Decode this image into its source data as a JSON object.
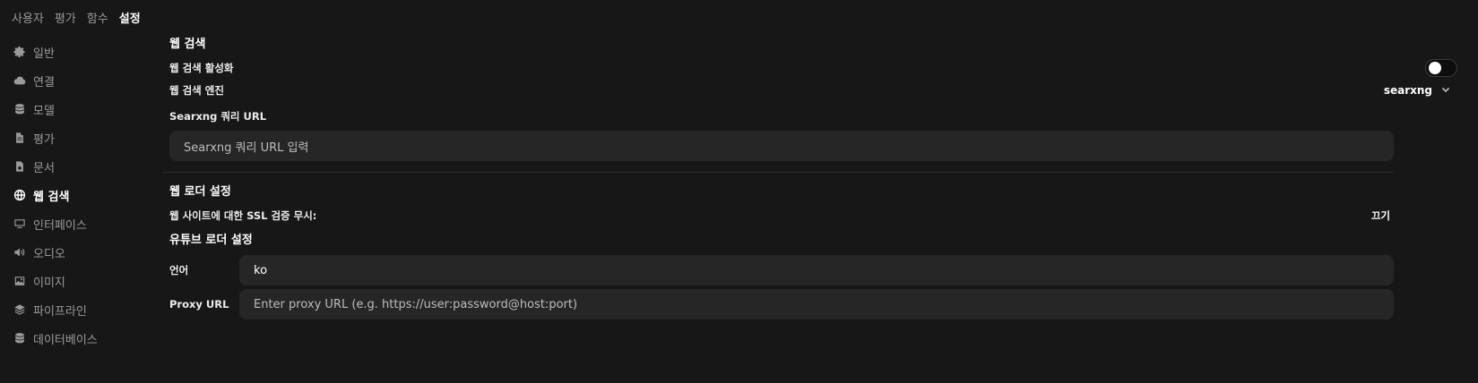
{
  "top_tabs": [
    {
      "label": "사용자"
    },
    {
      "label": "평가"
    },
    {
      "label": "함수"
    },
    {
      "label": "설정"
    }
  ],
  "sidebar": {
    "items": [
      {
        "label": "일반",
        "icon": "gear-icon"
      },
      {
        "label": "연결",
        "icon": "cloud-icon"
      },
      {
        "label": "모델",
        "icon": "database-icon"
      },
      {
        "label": "평가",
        "icon": "document-icon"
      },
      {
        "label": "문서",
        "icon": "file-icon"
      },
      {
        "label": "웹 검색",
        "icon": "globe-icon"
      },
      {
        "label": "인터페이스",
        "icon": "monitor-icon"
      },
      {
        "label": "오디오",
        "icon": "speaker-icon"
      },
      {
        "label": "이미지",
        "icon": "image-icon"
      },
      {
        "label": "파이프라인",
        "icon": "layers-icon"
      },
      {
        "label": "데이터베이스",
        "icon": "database-icon"
      }
    ]
  },
  "web_search": {
    "title": "웹 검색",
    "enable_label": "웹 검색 활성화",
    "enabled": false,
    "engine_label": "웹 검색 엔진",
    "engine_value": "searxng",
    "query_url_label": "Searxng 쿼리 URL",
    "query_url_placeholder": "Searxng 쿼리 URL 입력"
  },
  "web_loader": {
    "title": "웹 로더 설정",
    "ssl_label": "웹 사이트에 대한 SSL 검증 무시:",
    "ssl_value": "끄기"
  },
  "youtube_loader": {
    "title": "유튜브 로더 설정",
    "language_label": "언어",
    "language_value": "ko",
    "proxy_label": "Proxy URL",
    "proxy_placeholder": "Enter proxy URL (e.g. https://user:password@host:port)"
  },
  "colors": {
    "background": "#171717",
    "input_bg": "#262626",
    "text_muted": "#9a9a9a",
    "text_active": "#ffffff"
  }
}
